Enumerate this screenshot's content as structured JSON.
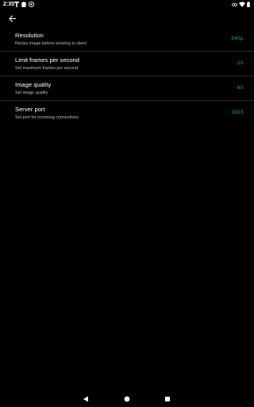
{
  "status_bar": {
    "time": "2:35",
    "left_icons": [
      "t-icon",
      "clipboard-icon",
      "notification-icon"
    ],
    "right_icons": [
      "link-icon",
      "wifi-icon",
      "battery-icon"
    ]
  },
  "toolbar": {
    "back_icon": "arrow-left-icon"
  },
  "colors": {
    "background": "#000000",
    "accent_value": "#2ea84f",
    "title": "#ffffff",
    "summary": "#bdbdbd",
    "divider": "#2a2a2a"
  },
  "settings": [
    {
      "title": "Resolution",
      "summary": "Resize image before sending to client",
      "value": "540p"
    },
    {
      "title": "Limit frames per second",
      "summary": "Set maximum frames per second",
      "value": "20"
    },
    {
      "title": "Image quality",
      "summary": "Set image quality",
      "value": "60"
    },
    {
      "title": "Server port",
      "summary": "Set port for incoming connections",
      "value": "3333"
    }
  ],
  "nav_bar": {
    "buttons": [
      "back-triangle-icon",
      "home-circle-icon",
      "recents-square-icon"
    ]
  }
}
